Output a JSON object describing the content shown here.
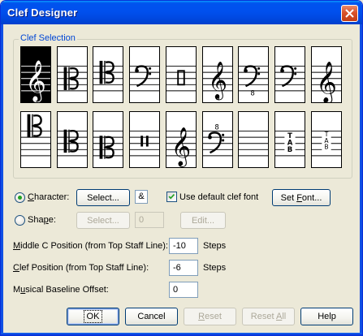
{
  "window": {
    "title": "Clef Designer"
  },
  "clef_selection": {
    "label": "Clef Selection",
    "row1": [
      {
        "name": "treble-clef",
        "selected": true
      },
      {
        "name": "alto-c-clef"
      },
      {
        "name": "tenor-c-clef"
      },
      {
        "name": "bass-clef"
      },
      {
        "name": "percussion-clef"
      },
      {
        "name": "treble-8vb-clef"
      },
      {
        "name": "bass-8vb-clef"
      },
      {
        "name": "bass-clef-high"
      },
      {
        "name": "french-violin-clef"
      }
    ],
    "row2": [
      {
        "name": "c-clef-top"
      },
      {
        "name": "mezzo-c-clef"
      },
      {
        "name": "baritone-c-clef"
      },
      {
        "name": "percussion-bars-clef"
      },
      {
        "name": "treble-8va-clef"
      },
      {
        "name": "bass-8va-clef"
      },
      {
        "name": "blank-clef"
      },
      {
        "name": "tab-clef-large"
      },
      {
        "name": "tab-clef-small"
      }
    ],
    "octave_mark": "8",
    "tab_letters": [
      "T",
      "A",
      "B"
    ]
  },
  "character": {
    "radio_label": "Character:",
    "select_label": "Select...",
    "char_value": "&",
    "default_font_label": "Use default clef font",
    "default_font_checked": true,
    "set_font_label": "Set Font..."
  },
  "shape": {
    "radio_label": "Shape:",
    "select_label": "Select...",
    "shape_value": "0",
    "edit_label": "Edit..."
  },
  "fields": {
    "middle_c_label": "Middle C Position (from Top Staff Line):",
    "middle_c_value": "-10",
    "middle_c_unit": "Steps",
    "clef_pos_label": "Clef Position (from Top Staff Line):",
    "clef_pos_value": "-6",
    "clef_pos_unit": "Steps",
    "baseline_label": "Musical Baseline Offset:",
    "baseline_value": "0"
  },
  "buttons": {
    "ok": "OK",
    "cancel": "Cancel",
    "reset": "Reset",
    "reset_all": "Reset All",
    "help": "Help"
  },
  "colors": {
    "title_bar": "#0050ee",
    "group_label": "#0046d5",
    "selected_cell": "#000000"
  }
}
